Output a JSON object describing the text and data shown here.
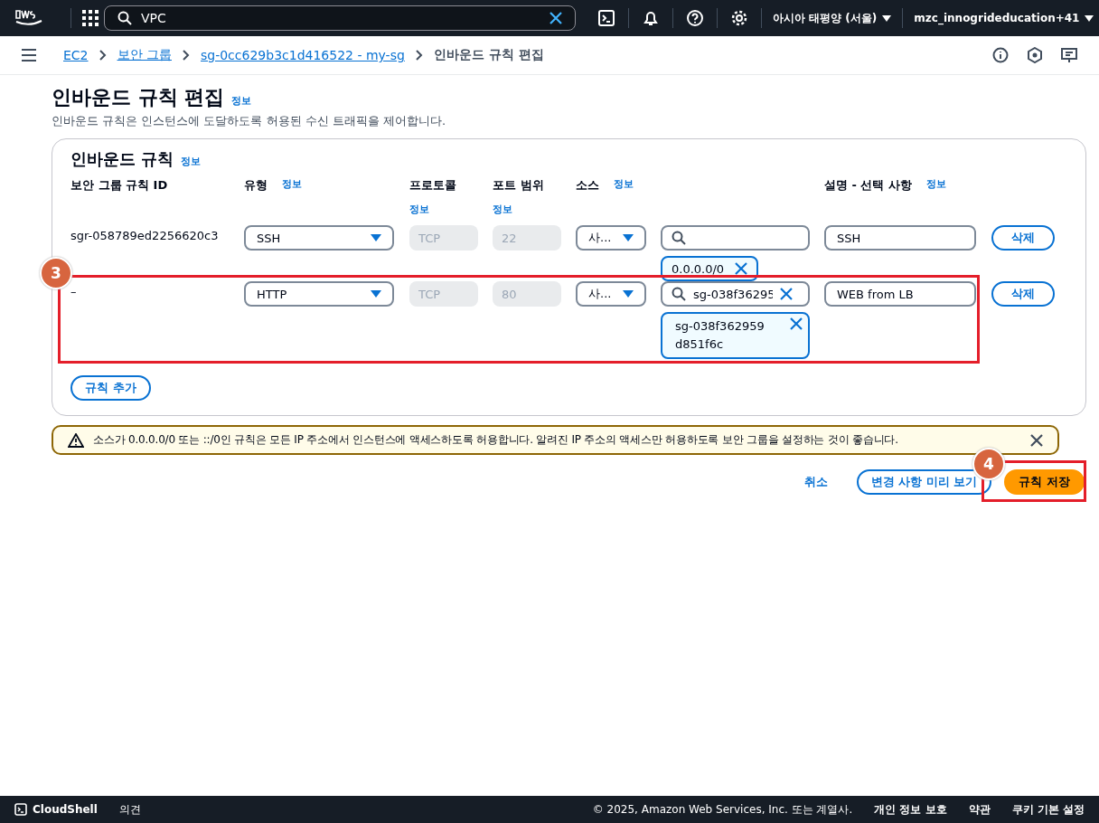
{
  "top_nav": {
    "search": {
      "value": "VPC"
    },
    "region": "아시아 태평양 (서울)",
    "account": "mzc_innogrideducation+41"
  },
  "breadcrumbs": [
    {
      "label": "EC2",
      "link": true
    },
    {
      "label": "보안 그룹",
      "link": true
    },
    {
      "label": "sg-0cc629b3c1d416522 - my-sg",
      "link": true
    },
    {
      "label": "인바운드 규칙 편집",
      "link": false
    }
  ],
  "page": {
    "title": "인바운드 규칙 편집",
    "info": "정보",
    "description": "인바운드 규칙은 인스턴스에 도달하도록 허용된 수신 트래픽을 제어합니다."
  },
  "rules_panel": {
    "title": "인바운드 규칙",
    "info": "정보",
    "columns": [
      {
        "label": "보안 그룹 규칙 ID"
      },
      {
        "label": "유형",
        "info": "정보"
      },
      {
        "label": "프로토콜",
        "info_below": "정보"
      },
      {
        "label": "포트 범위",
        "info_below": "정보"
      },
      {
        "label": "소스",
        "info": "정보"
      },
      {
        "label": "설명 - 선택 사항",
        "info": "정보"
      }
    ],
    "rows": [
      {
        "rule_id": "sgr-058789ed2256620c3",
        "type": "SSH",
        "protocol": "TCP",
        "port": "22",
        "source_type": "사...",
        "source_search": "",
        "source_token": "0.0.0.0/0",
        "description": "SSH",
        "delete": "삭제",
        "highlighted": false
      },
      {
        "rule_id": "–",
        "type": "HTTP",
        "protocol": "TCP",
        "port": "80",
        "source_type": "사...",
        "source_search": "sg-038f36295",
        "source_token": "sg-038f362959d851f6c",
        "description": "WEB from LB",
        "delete": "삭제",
        "highlighted": true
      }
    ],
    "add_button": "규칙 추가"
  },
  "warning": {
    "text": "소스가 0.0.0.0/0 또는 ::/0인 규칙은 모든 IP 주소에서 인스턴스에 액세스하도록 허용합니다. 알려진 IP 주소의 액세스만 허용하도록 보안 그룹을 설정하는 것이 좋습니다."
  },
  "actions": {
    "cancel": "취소",
    "preview": "변경 사항 미리 보기",
    "save": "규칙 저장"
  },
  "step_badges": [
    "3",
    "4"
  ],
  "footer": {
    "cloudshell": "CloudShell",
    "feedback": "의견",
    "copyright": "© 2025, Amazon Web Services, Inc. 또는 계열사.",
    "links": [
      "개인 정보 보호",
      "약관",
      "쿠키 기본 설정"
    ]
  }
}
